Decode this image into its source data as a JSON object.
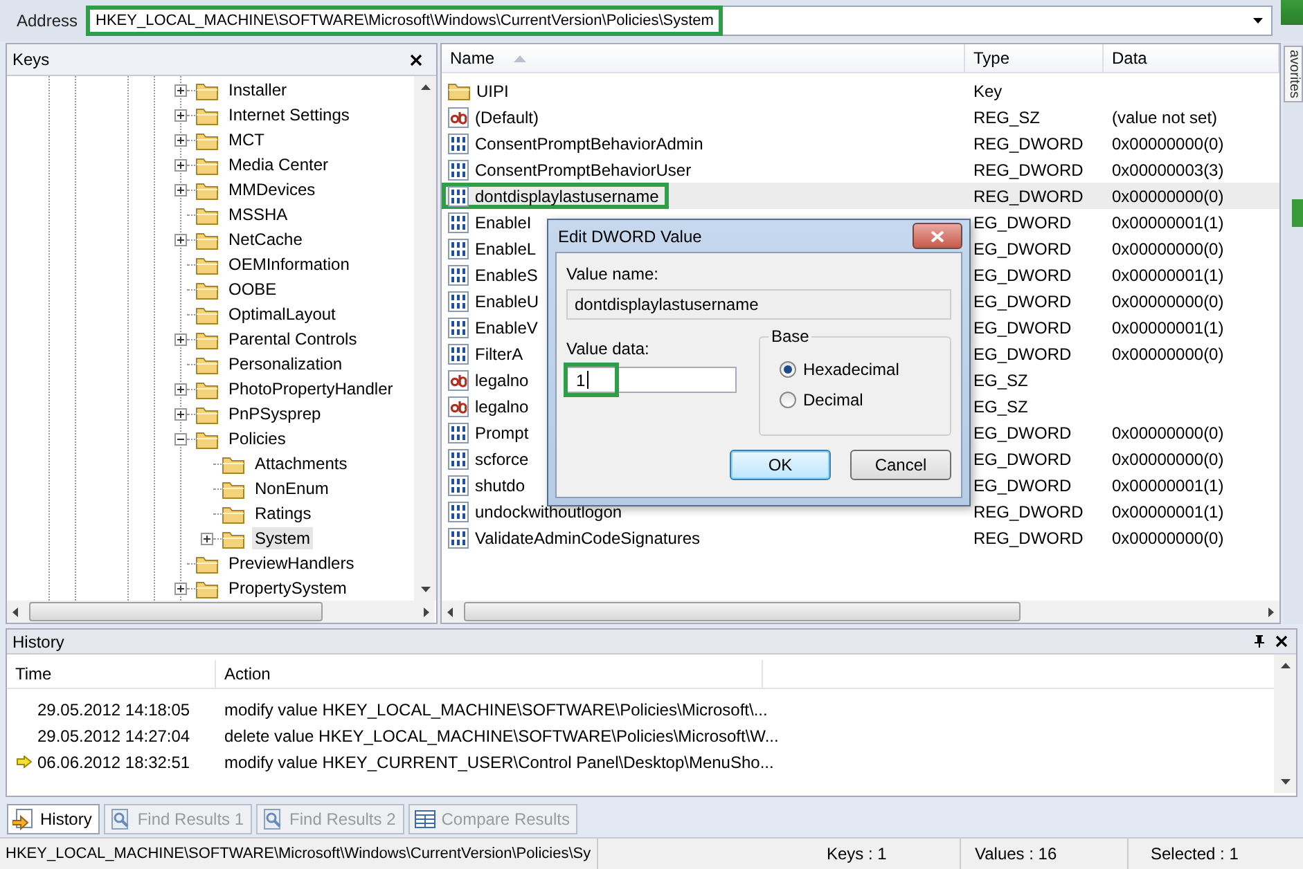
{
  "address": {
    "label": "Address",
    "value": "HKEY_LOCAL_MACHINE\\SOFTWARE\\Microsoft\\Windows\\CurrentVersion\\Policies\\System",
    "highlighted": true
  },
  "keys_pane": {
    "title": "Keys"
  },
  "tree": [
    {
      "kind": "collapsed",
      "label": "Installer",
      "selected": false
    },
    {
      "kind": "collapsed",
      "label": "Internet Settings",
      "selected": false
    },
    {
      "kind": "collapsed",
      "label": "MCT",
      "selected": false
    },
    {
      "kind": "collapsed",
      "label": "Media Center",
      "selected": false
    },
    {
      "kind": "collapsed",
      "label": "MMDevices",
      "selected": false
    },
    {
      "kind": "leaf",
      "label": "MSSHA",
      "selected": false
    },
    {
      "kind": "collapsed",
      "label": "NetCache",
      "selected": false
    },
    {
      "kind": "leaf",
      "label": "OEMInformation",
      "selected": false
    },
    {
      "kind": "leaf",
      "label": "OOBE",
      "selected": false
    },
    {
      "kind": "leaf",
      "label": "OptimalLayout",
      "selected": false
    },
    {
      "kind": "collapsed",
      "label": "Parental Controls",
      "selected": false
    },
    {
      "kind": "leaf",
      "label": "Personalization",
      "selected": false
    },
    {
      "kind": "collapsed",
      "label": "PhotoPropertyHandler",
      "selected": false
    },
    {
      "kind": "collapsed",
      "label": "PnPSysprep",
      "selected": false
    },
    {
      "kind": "expanded",
      "label": "Policies",
      "selected": false,
      "children": [
        {
          "kind": "leaf",
          "label": "Attachments",
          "selected": false
        },
        {
          "kind": "leaf",
          "label": "NonEnum",
          "selected": false
        },
        {
          "kind": "leaf",
          "label": "Ratings",
          "selected": false
        },
        {
          "kind": "collapsed",
          "label": "System",
          "selected": true
        }
      ]
    },
    {
      "kind": "leaf",
      "label": "PreviewHandlers",
      "selected": false
    },
    {
      "kind": "collapsed",
      "label": "PropertySystem",
      "selected": false
    }
  ],
  "values": {
    "columns": [
      {
        "label": "Name",
        "sorted": true
      },
      {
        "label": "Type",
        "sorted": false
      },
      {
        "label": "Data",
        "sorted": false
      }
    ],
    "rows": [
      {
        "kind": "key",
        "name": "UIPI",
        "type": "Key",
        "selected": false,
        "highlighted": false
      },
      {
        "kind": "string",
        "name": "(Default)",
        "type": "REG_SZ",
        "data": "(value not set)",
        "selected": false,
        "highlighted": false
      },
      {
        "kind": "dword",
        "name": "ConsentPromptBehaviorAdmin",
        "type": "REG_DWORD",
        "data": "0x00000000(0)",
        "selected": false,
        "highlighted": false
      },
      {
        "kind": "dword",
        "name": "ConsentPromptBehaviorUser",
        "type": "REG_DWORD",
        "data": "0x00000003(3)",
        "selected": false,
        "highlighted": false
      },
      {
        "kind": "dword",
        "name": "dontdisplaylastusername",
        "type": "REG_DWORD",
        "data": "0x00000000(0)",
        "selected": true,
        "highlighted": true
      },
      {
        "kind": "dword",
        "name": "EnableI",
        "type": "EG_DWORD",
        "data": "0x00000001(1)",
        "selected": false,
        "highlighted": false
      },
      {
        "kind": "dword",
        "name": "EnableL",
        "type": "EG_DWORD",
        "data": "0x00000000(0)",
        "selected": false,
        "highlighted": false
      },
      {
        "kind": "dword",
        "name": "EnableS",
        "type": "EG_DWORD",
        "data": "0x00000001(1)",
        "selected": false,
        "highlighted": false
      },
      {
        "kind": "dword",
        "name": "EnableU",
        "type": "EG_DWORD",
        "data": "0x00000000(0)",
        "selected": false,
        "highlighted": false
      },
      {
        "kind": "dword",
        "name": "EnableV",
        "type": "EG_DWORD",
        "data": "0x00000001(1)",
        "selected": false,
        "highlighted": false
      },
      {
        "kind": "dword",
        "name": "FilterA",
        "type": "EG_DWORD",
        "data": "0x00000000(0)",
        "selected": false,
        "highlighted": false
      },
      {
        "kind": "string",
        "name": "legalno",
        "type": "EG_SZ",
        "selected": false,
        "highlighted": false
      },
      {
        "kind": "string",
        "name": "legalno",
        "type": "EG_SZ",
        "selected": false,
        "highlighted": false
      },
      {
        "kind": "dword",
        "name": "Prompt",
        "type": "EG_DWORD",
        "data": "0x00000000(0)",
        "selected": false,
        "highlighted": false
      },
      {
        "kind": "dword",
        "name": "scforce",
        "type": "EG_DWORD",
        "data": "0x00000000(0)",
        "selected": false,
        "highlighted": false
      },
      {
        "kind": "dword",
        "name": "shutdo",
        "type": "EG_DWORD",
        "data": "0x00000001(1)",
        "selected": false,
        "highlighted": false
      },
      {
        "kind": "dword",
        "name": "undockwithoutlogon",
        "type": "REG_DWORD",
        "data": "0x00000001(1)",
        "selected": false,
        "highlighted": false
      },
      {
        "kind": "dword",
        "name": "ValidateAdminCodeSignatures",
        "type": "REG_DWORD",
        "data": "0x00000000(0)",
        "selected": false,
        "highlighted": false
      }
    ]
  },
  "favorites_tab": "avorites",
  "dialog": {
    "title": "Edit DWORD Value",
    "value_name_label": "Value name:",
    "value_name": "dontdisplaylastusername",
    "value_data_label": "Value data:",
    "value_data": "1",
    "value_data_highlighted": true,
    "base_label": "Base",
    "bases": [
      {
        "label": "Hexadecimal",
        "selected": true
      },
      {
        "label": "Decimal",
        "selected": false
      }
    ],
    "buttons": [
      {
        "label": "OK",
        "default": true
      },
      {
        "label": "Cancel",
        "default": false
      }
    ]
  },
  "history": {
    "title": "History",
    "columns": [
      "Time",
      "Action"
    ],
    "rows": [
      {
        "time": "29.05.2012 14:18:05",
        "action": "modify value HKEY_LOCAL_MACHINE\\SOFTWARE\\Policies\\Microsoft\\...",
        "current": false
      },
      {
        "time": "29.05.2012 14:27:04",
        "action": "delete value HKEY_LOCAL_MACHINE\\SOFTWARE\\Policies\\Microsoft\\W...",
        "current": false
      },
      {
        "time": "06.06.2012 18:32:51",
        "action": "modify value HKEY_CURRENT_USER\\Control Panel\\Desktop\\MenuSho...",
        "current": true
      }
    ]
  },
  "bottom_tabs": [
    {
      "kind": "history",
      "label": "History",
      "selected": true
    },
    {
      "kind": "find",
      "label": "Find Results 1",
      "selected": false
    },
    {
      "kind": "find",
      "label": "Find Results 2",
      "selected": false
    },
    {
      "kind": "compare",
      "label": "Compare Results",
      "selected": false
    }
  ],
  "status_bar": {
    "path": "HKEY_LOCAL_MACHINE\\SOFTWARE\\Microsoft\\Windows\\CurrentVersion\\Policies\\Sy",
    "keys": "Keys : 1",
    "values": "Values : 16",
    "selected": "Selected : 1"
  }
}
